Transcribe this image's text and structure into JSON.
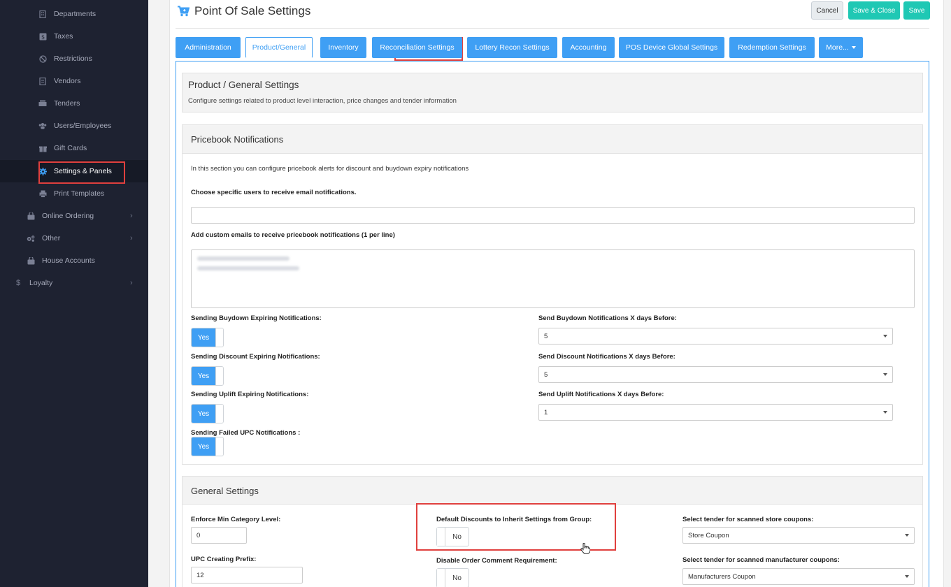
{
  "sidebar": {
    "items": [
      {
        "label": "Departments",
        "icon": "building-icon"
      },
      {
        "label": "Taxes",
        "icon": "dollar-box-icon"
      },
      {
        "label": "Restrictions",
        "icon": "ban-icon"
      },
      {
        "label": "Vendors",
        "icon": "document-icon"
      },
      {
        "label": "Tenders",
        "icon": "cash-icon"
      },
      {
        "label": "Users/Employees",
        "icon": "users-icon"
      },
      {
        "label": "Gift Cards",
        "icon": "gift-icon"
      },
      {
        "label": "Settings & Panels",
        "icon": "gear-icon"
      },
      {
        "label": "Print Templates",
        "icon": "printer-icon"
      },
      {
        "label": "Online Ordering",
        "icon": "bag-icon"
      },
      {
        "label": "Other",
        "icon": "gears-icon"
      },
      {
        "label": "House Accounts",
        "icon": "bag-icon"
      },
      {
        "label": "Loyalty",
        "icon": "dollar-icon"
      }
    ]
  },
  "header": {
    "title": "Point Of Sale Settings",
    "cancel_label": "Cancel",
    "save_close_label": "Save & Close",
    "save_label": "Save"
  },
  "tabs": [
    {
      "label": "Administration"
    },
    {
      "label": "Product/General"
    },
    {
      "label": "Inventory"
    },
    {
      "label": "Reconciliation Settings"
    },
    {
      "label": "Lottery Recon Settings"
    },
    {
      "label": "Accounting"
    },
    {
      "label": "POS Device Global Settings"
    },
    {
      "label": "Redemption Settings"
    },
    {
      "label": "More..."
    }
  ],
  "product_general": {
    "title": "Product / General Settings",
    "subtitle": "Configure settings related to product level interaction, price changes and tender information"
  },
  "pricebook": {
    "title": "Pricebook Notifications",
    "intro": "In this section you can configure pricebook alerts for discount and buydown expiry notifications",
    "users_label": "Choose specific users to receive email notifications.",
    "users_value": "",
    "emails_label": "Add custom emails to receive pricebook notifications (1 per line)",
    "buydown_label": "Sending Buydown Expiring Notifications:",
    "buydown_value": "Yes",
    "discount_label": "Sending Discount Expiring Notifications:",
    "discount_value": "Yes",
    "uplift_label": "Sending Uplift Expiring Notifications:",
    "uplift_value": "Yes",
    "failed_upc_label": "Sending Failed UPC Notifications :",
    "failed_upc_value": "Yes",
    "buydown_days_label": "Send Buydown Notifications X days Before:",
    "buydown_days_value": "5",
    "discount_days_label": "Send Discount Notifications X days Before:",
    "discount_days_value": "5",
    "uplift_days_label": "Send Uplift Notifications X days Before:",
    "uplift_days_value": "1"
  },
  "general": {
    "title": "General Settings",
    "min_cat_label": "Enforce Min Category Level:",
    "min_cat_value": "0",
    "upc_prefix_label": "UPC Creating Prefix:",
    "upc_prefix_value": "12",
    "inherit_label": "Default Discounts to Inherit Settings from Group:",
    "inherit_value": "No",
    "order_comment_label": "Disable Order Comment Requirement:",
    "order_comment_value": "No",
    "store_coupon_label": "Select tender for scanned store coupons:",
    "store_coupon_value": "Store Coupon",
    "mfr_coupon_label": "Select tender for scanned manufacturer coupons:",
    "mfr_coupon_value": "Manufacturers Coupon"
  },
  "colors": {
    "accent": "#3f9ff4",
    "teal": "#1fc8b4",
    "sidebar_bg": "#1e2231",
    "highlight": "#e0403e"
  }
}
